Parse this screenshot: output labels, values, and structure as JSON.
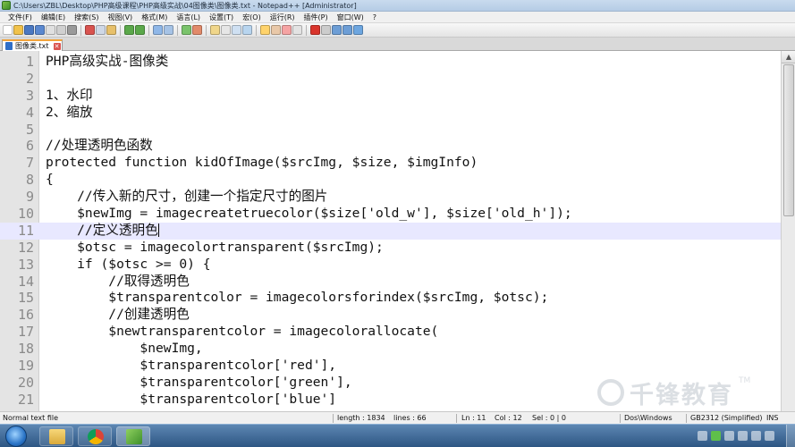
{
  "window": {
    "title": "C:\\Users\\ZBL\\Desktop\\PHP高级课程\\PHP高级实战\\04图像类\\图像类.txt - Notepad++ [Administrator]"
  },
  "menu": [
    "文件(F)",
    "编辑(E)",
    "搜索(S)",
    "视图(V)",
    "格式(M)",
    "语言(L)",
    "设置(T)",
    "宏(O)",
    "运行(R)",
    "插件(P)",
    "窗口(W)",
    "?"
  ],
  "tab": {
    "label": "图像类.txt"
  },
  "editor": {
    "current_line": 11,
    "lines": [
      {
        "n": "1",
        "text": "PHP高级实战-图像类"
      },
      {
        "n": "2",
        "text": ""
      },
      {
        "n": "3",
        "text": "1、水印"
      },
      {
        "n": "4",
        "text": "2、缩放"
      },
      {
        "n": "5",
        "text": ""
      },
      {
        "n": "6",
        "text": "//处理透明色函数"
      },
      {
        "n": "7",
        "text": "protected function kidOfImage($srcImg, $size, $imgInfo)"
      },
      {
        "n": "8",
        "text": "{"
      },
      {
        "n": "9",
        "text": "    //传入新的尺寸，创建一个指定尺寸的图片"
      },
      {
        "n": "10",
        "text": "    $newImg = imagecreatetruecolor($size['old_w'], $size['old_h']);"
      },
      {
        "n": "11",
        "text": "    //定义透明色"
      },
      {
        "n": "12",
        "text": "    $otsc = imagecolortransparent($srcImg);"
      },
      {
        "n": "13",
        "text": "    if ($otsc >= 0) {"
      },
      {
        "n": "14",
        "text": "        //取得透明色"
      },
      {
        "n": "15",
        "text": "        $transparentcolor = imagecolorsforindex($srcImg, $otsc);"
      },
      {
        "n": "16",
        "text": "        //创建透明色"
      },
      {
        "n": "17",
        "text": "        $newtransparentcolor = imagecolorallocate("
      },
      {
        "n": "18",
        "text": "            $newImg,"
      },
      {
        "n": "19",
        "text": "            $transparentcolor['red'],"
      },
      {
        "n": "20",
        "text": "            $transparentcolor['green'],"
      },
      {
        "n": "21",
        "text": "            $transparentcolor['blue']"
      }
    ]
  },
  "watermark": {
    "text": "千锋教育",
    "tm": "TM"
  },
  "status": {
    "file_type": "Normal text file",
    "length": "length : 1834",
    "lines": "lines : 66",
    "ln": "Ln : 11",
    "col": "Col : 12",
    "sel": "Sel : 0 | 0",
    "eol": "Dos\\Windows",
    "encoding": "GB2312 (Simplified)",
    "mode": "INS"
  },
  "colors": {
    "current_line_bg": "#e8e8ff",
    "line_number": "#8a8a8a",
    "tab_accent": "#f2a33a"
  }
}
